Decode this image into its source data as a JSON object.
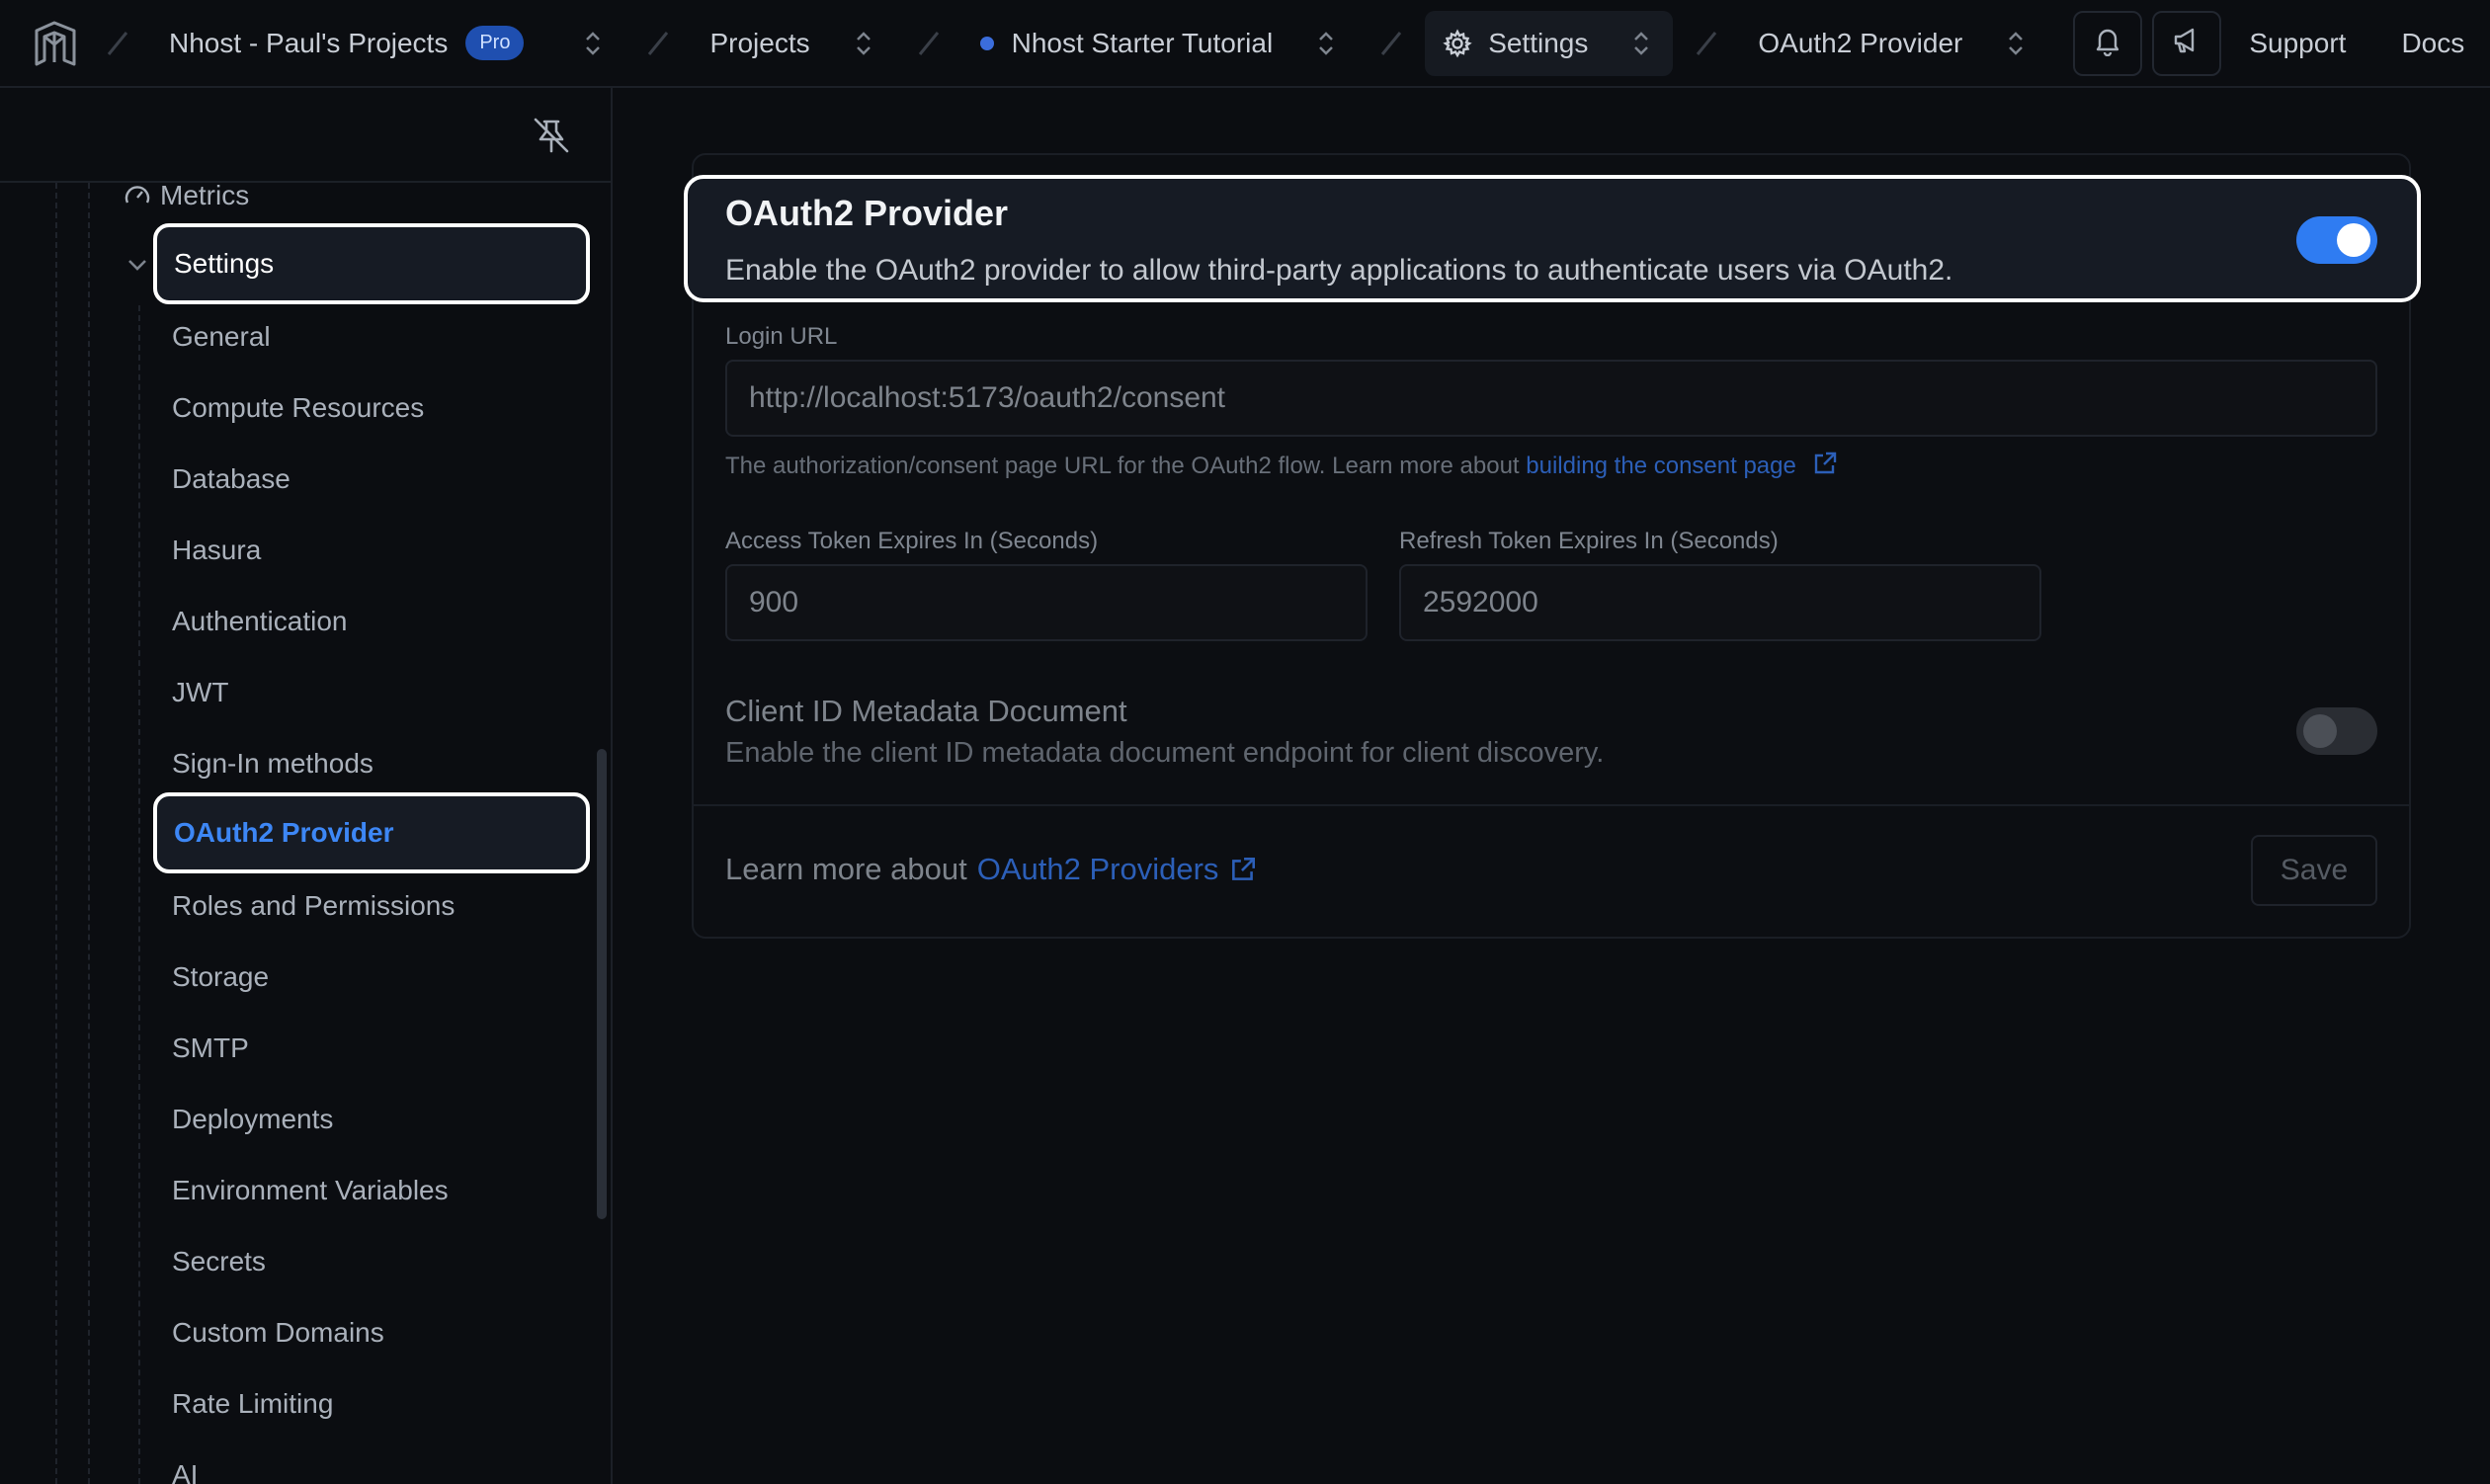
{
  "topbar": {
    "org": "Nhost - Paul's Projects",
    "org_badge": "Pro",
    "projects": "Projects",
    "project": "Nhost Starter Tutorial",
    "section": "Settings",
    "page": "OAuth2 Provider",
    "support": "Support",
    "docs": "Docs"
  },
  "sidebar": {
    "metrics": "Metrics",
    "settings": "Settings",
    "items": [
      "General",
      "Compute Resources",
      "Database",
      "Hasura",
      "Authentication",
      "JWT",
      "Sign-In methods",
      "OAuth2 Provider",
      "Roles and Permissions",
      "Storage",
      "SMTP",
      "Deployments",
      "Environment Variables",
      "Secrets",
      "Custom Domains",
      "Rate Limiting",
      "AI"
    ],
    "active_item": "OAuth2 Provider"
  },
  "main": {
    "title": "OAuth2 Provider",
    "description": "Enable the OAuth2 provider to allow third-party applications to authenticate users via OAuth2.",
    "enabled": true,
    "login_url_label": "Login URL",
    "login_url_value": "http://localhost:5173/oauth2/consent",
    "login_url_help": "The authorization/consent page URL for the OAuth2 flow. Learn more about",
    "login_url_help_link": "building the consent page",
    "access_token_label": "Access Token Expires In (Seconds)",
    "access_token_value": "900",
    "refresh_token_label": "Refresh Token Expires In (Seconds)",
    "refresh_token_value": "2592000",
    "client_id_title": "Client ID Metadata Document",
    "client_id_desc": "Enable the client ID metadata document endpoint for client discovery.",
    "client_id_enabled": false,
    "learn_more_prefix": "Learn more about",
    "learn_more_link": "OAuth2 Providers",
    "save_label": "Save"
  },
  "colors": {
    "accent": "#2f7cf2",
    "active_nav_text": "#3d87f5",
    "link": "#2c5fb8",
    "background": "#0b0d11"
  }
}
